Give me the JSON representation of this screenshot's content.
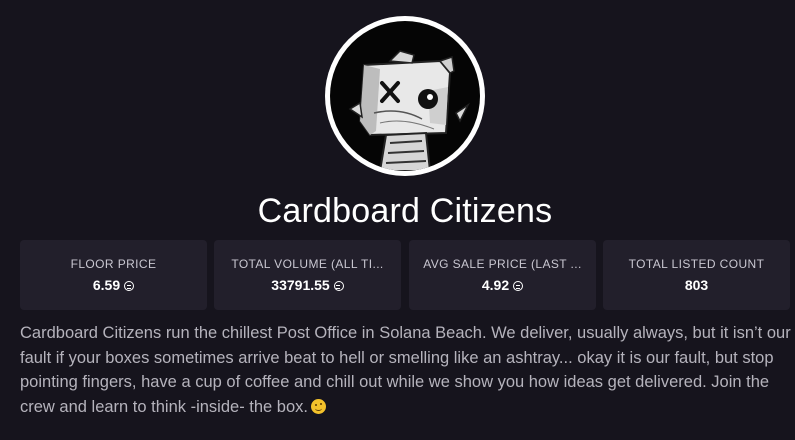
{
  "collection": {
    "name": "Cardboard Citizens",
    "avatar_icon": "cardboard-box-character-icon"
  },
  "stats": [
    {
      "label": "FLOOR PRICE",
      "value": "6.59",
      "icon": "solana-icon"
    },
    {
      "label": "TOTAL VOLUME (ALL TI...",
      "value": "33791.55",
      "icon": "solana-icon"
    },
    {
      "label": "AVG SALE PRICE (LAST ...",
      "value": "4.92",
      "icon": "solana-icon"
    },
    {
      "label": "TOTAL LISTED COUNT",
      "value": "803"
    }
  ],
  "description": "Cardboard Citizens run the chillest Post Office in Solana Beach. We deliver, usually always, but it isn’t our fault if your boxes sometimes arrive beat to hell or smelling like an ashtray... okay it is our fault, but stop pointing fingers, have a cup of coffee and chill out while we show you how ideas get delivered. Join the crew and learn to think -inside- the box.",
  "description_emoji": "winking-face-emoji",
  "colors": {
    "background": "#16141d",
    "card": "#221f2b",
    "text_muted": "#b5b3bc"
  }
}
